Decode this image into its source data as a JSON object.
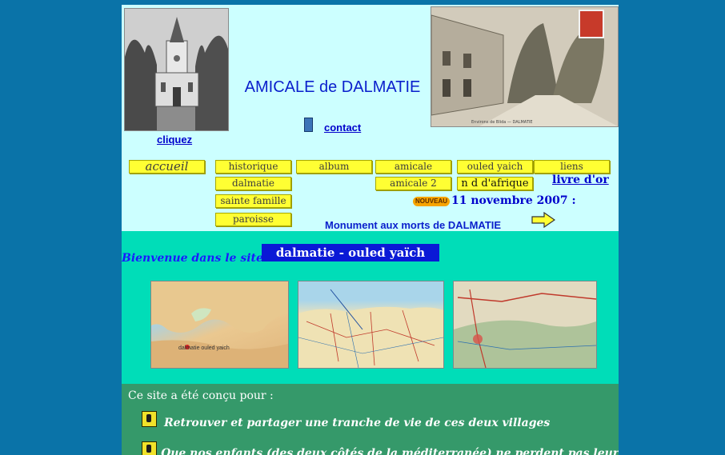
{
  "header": {
    "title": "AMICALE de DALMATIE",
    "contact_label": "contact",
    "cliquez_label": "cliquez"
  },
  "nav": {
    "accueil": "accueil",
    "historique": "historique",
    "album": "album",
    "amicale": "amicale",
    "ouled_yaich": "ouled yaich",
    "liens": "liens",
    "dalmatie": "dalmatie",
    "amicale2": "amicale 2",
    "nd_afrique": "n d d'afrique",
    "sainte_famille": "sainte famille",
    "paroisse": "paroisse"
  },
  "livre_dor_label": "livre d'or",
  "news": {
    "badge": "NOUVEAU",
    "date": "11 novembre 2007 :",
    "headline": "Monument aux morts de DALMATIE"
  },
  "welcome": {
    "text": "Bienvenue dans le site de :",
    "banner": "dalmatie - ouled yaïch"
  },
  "maps": {
    "map1_label": "dalmatie ouled yaich"
  },
  "intro": {
    "heading": "Ce site a été conçu pour :",
    "bullets": [
      "Retrouver et partager une tranche de vie de ces deux villages",
      "Que nos enfants (des deux côtés de la méditerranée) ne perdent pas leurs racines"
    ]
  },
  "colors": {
    "page_bg": "#0a73a8",
    "header_bg": "#ccffff",
    "welcome_bg": "#00ddb8",
    "intro_bg": "#35996a",
    "nav_button": "#ffff33",
    "banner_bg": "#0a19d6"
  }
}
